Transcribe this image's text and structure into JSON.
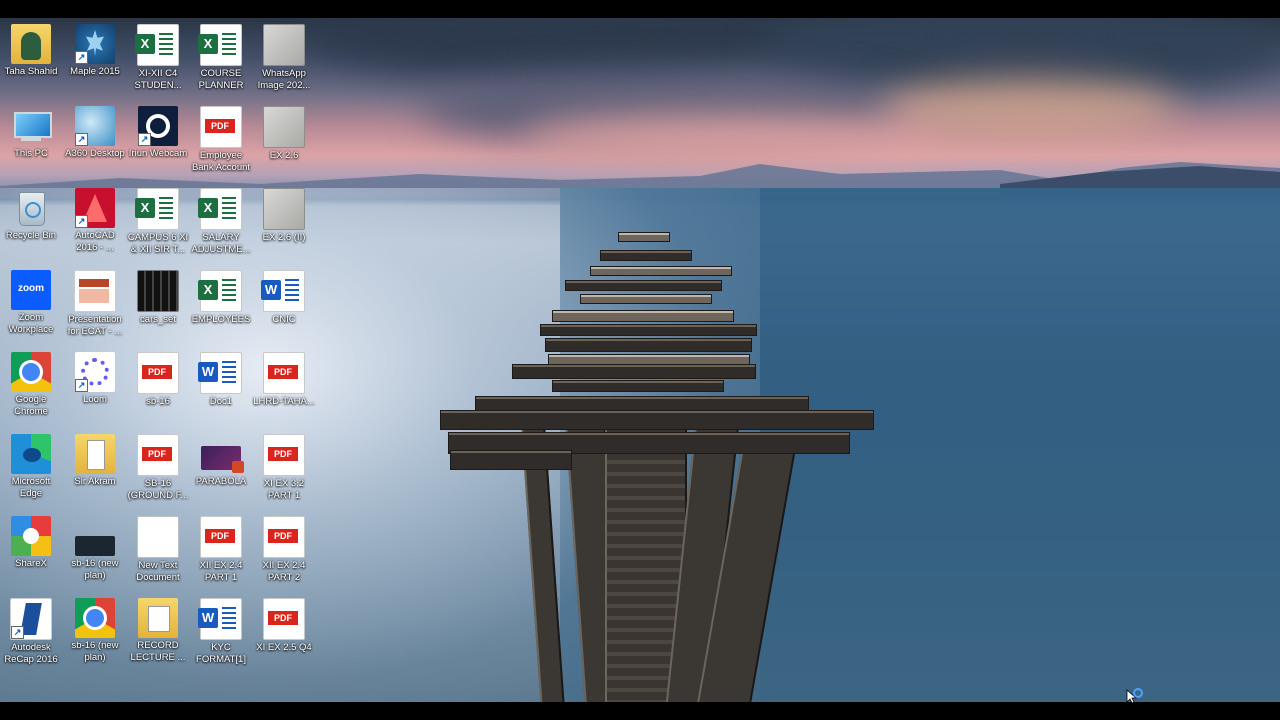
{
  "desktop": {
    "icons": [
      {
        "label": "Taha Shahid",
        "icon": "user-folder-icon"
      },
      {
        "label": "Maple 2015",
        "icon": "maple-icon"
      },
      {
        "label": "XI-XII C4 STUDEN...",
        "icon": "excel-icon"
      },
      {
        "label": "COURSE PLANNER",
        "icon": "excel-icon"
      },
      {
        "label": "WhatsApp Image 202...",
        "icon": "image-icon"
      },
      {
        "label": "This PC",
        "icon": "computer-icon"
      },
      {
        "label": "A360 Desktop",
        "icon": "a360-icon"
      },
      {
        "label": "Iriun Webcam",
        "icon": "webcam-icon"
      },
      {
        "label": "Employee Bank Account",
        "icon": "pdf-icon"
      },
      {
        "label": "EX 2.6",
        "icon": "image-icon"
      },
      {
        "label": "Recycle Bin",
        "icon": "recycle-bin-icon"
      },
      {
        "label": "AutoCAD 2016 - ...",
        "icon": "autocad-icon"
      },
      {
        "label": "CAMPUS 6 XI & XII SIR T...",
        "icon": "excel-icon"
      },
      {
        "label": "SALARY ADJUSTME...",
        "icon": "excel-icon"
      },
      {
        "label": "EX 2.6 (II)",
        "icon": "image-icon"
      },
      {
        "label": "Zoom Workplace",
        "icon": "zoom-icon"
      },
      {
        "label": "Presentation for ECAT - ...",
        "icon": "powerpoint-icon"
      },
      {
        "label": "cars_set",
        "icon": "image-icon"
      },
      {
        "label": "EMPLOYEES",
        "icon": "excel-icon"
      },
      {
        "label": "CNIC",
        "icon": "word-icon"
      },
      {
        "label": "Google Chrome",
        "icon": "chrome-icon"
      },
      {
        "label": "Loom",
        "icon": "loom-icon"
      },
      {
        "label": "sb-16",
        "icon": "pdf-icon"
      },
      {
        "label": "Doc1",
        "icon": "word-icon"
      },
      {
        "label": "LHRD-TAHA...",
        "icon": "pdf-icon"
      },
      {
        "label": "Microsoft Edge",
        "icon": "edge-icon"
      },
      {
        "label": "Sir Akram",
        "icon": "folder-icon"
      },
      {
        "label": "SB-16 (GROUND F...",
        "icon": "pdf-icon"
      },
      {
        "label": "PARABOLA",
        "icon": "powerpoint-icon"
      },
      {
        "label": "XI EX 3.2 PART 1",
        "icon": "pdf-icon"
      },
      {
        "label": "ShareX",
        "icon": "sharex-icon"
      },
      {
        "label": "sb-16 (new plan)",
        "icon": "image-icon"
      },
      {
        "label": "New Text Document",
        "icon": "text-file-icon"
      },
      {
        "label": "XII EX 2.4 PART 1",
        "icon": "pdf-icon"
      },
      {
        "label": "XII EX 2.4 PART 2",
        "icon": "pdf-icon"
      },
      {
        "label": "Autodesk ReCap 2016",
        "icon": "recap-icon"
      },
      {
        "label": "sb-16 (new plan)",
        "icon": "chrome-icon"
      },
      {
        "label": "RECORD LECTURE ...",
        "icon": "folder-icon"
      },
      {
        "label": "KYC FORMAT[1]",
        "icon": "word-icon"
      },
      {
        "label": "XI EX 2.5 Q4",
        "icon": "pdf-icon"
      }
    ]
  },
  "glyphs": {
    "excel": "X",
    "word": "W",
    "pdf": "PDF",
    "shortcut": "↗"
  }
}
